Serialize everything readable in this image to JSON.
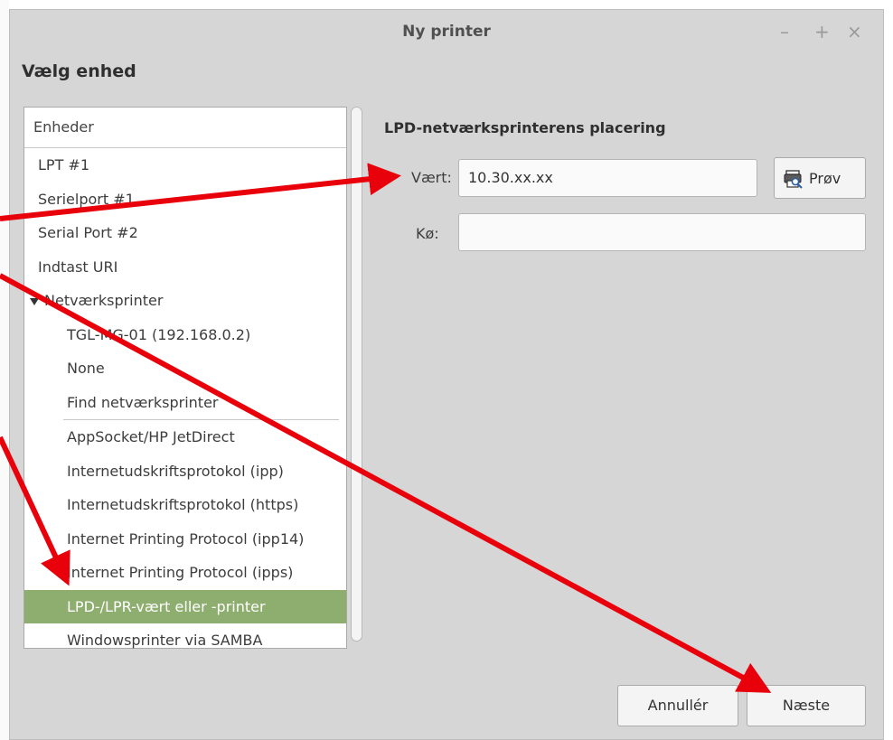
{
  "window": {
    "title": "Ny printer",
    "controls": {
      "minimize": "–",
      "maximize": "+",
      "close": "×"
    }
  },
  "heading": "Vælg enhed",
  "devices": {
    "header": "Enheder",
    "items": [
      {
        "label": "LPT #1"
      },
      {
        "label": "Serielport #1"
      },
      {
        "label": "Serial Port #2"
      },
      {
        "label": "Indtast URI"
      },
      {
        "label": "Netværksprinter"
      },
      {
        "label": "TGL-MG-01 (192.168.0.2)"
      },
      {
        "label": "None"
      },
      {
        "label": "Find netværksprinter"
      },
      {
        "label": "AppSocket/HP JetDirect"
      },
      {
        "label": "Internetudskriftsprotokol (ipp)"
      },
      {
        "label": "Internetudskriftsprotokol (https)"
      },
      {
        "label": "Internet Printing Protocol (ipp14)"
      },
      {
        "label": "Internet Printing Protocol (ipps)"
      },
      {
        "label": "LPD-/LPR-vært eller -printer"
      },
      {
        "label": "Windowsprinter via SAMBA"
      }
    ]
  },
  "lpd": {
    "section_title": "LPD-netværksprinterens placering",
    "host_label": "Vært:",
    "host_value": "10.30.xx.xx",
    "queue_label": "Kø:",
    "queue_value": "",
    "probe_label": "Prøv"
  },
  "footer": {
    "cancel_label": "Annullér",
    "next_label": "Næste"
  },
  "colors": {
    "selection": "#8eae6f",
    "annotation_arrow": "#e8000b",
    "window_bg": "#d6d6d6"
  }
}
